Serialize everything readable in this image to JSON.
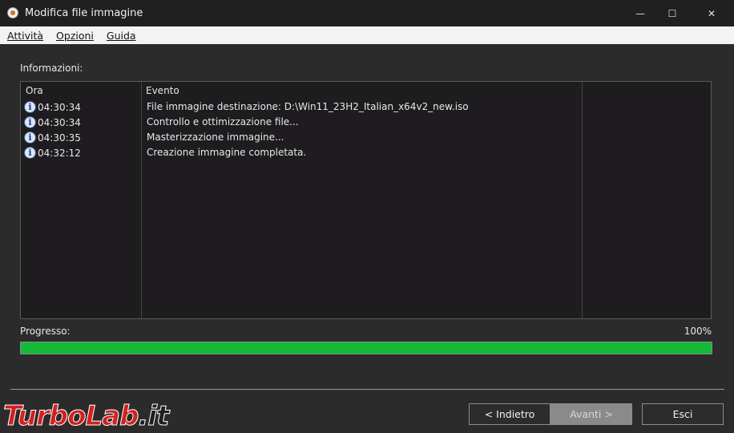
{
  "window": {
    "title": "Modifica file immagine",
    "controls": {
      "minimize": "—",
      "maximize": "☐",
      "close": "✕"
    }
  },
  "menu": {
    "items": [
      {
        "label": "Attività"
      },
      {
        "label": "Opzioni"
      },
      {
        "label": "Guida"
      }
    ]
  },
  "info": {
    "label": "Informazioni:",
    "columns": {
      "time": "Ora",
      "event": "Evento"
    },
    "rows": [
      {
        "icon": "info-icon",
        "time": "04:30:34",
        "event": "File immagine destinazione: D:\\Win11_23H2_Italian_x64v2_new.iso"
      },
      {
        "icon": "info-icon",
        "time": "04:30:34",
        "event": "Controllo e ottimizzazione file..."
      },
      {
        "icon": "info-icon",
        "time": "04:30:35",
        "event": "Masterizzazione immagine..."
      },
      {
        "icon": "info-icon",
        "time": "04:32:12",
        "event": "Creazione immagine completata."
      }
    ]
  },
  "progress": {
    "label": "Progresso:",
    "percent_text": "100%",
    "fraction": 1.0,
    "color": "#16b83a"
  },
  "buttons": {
    "back": "< Indietro",
    "next": "Avanti >",
    "exit": "Esci"
  },
  "watermark": {
    "part1": "TurboLab",
    "part2": ".it"
  }
}
